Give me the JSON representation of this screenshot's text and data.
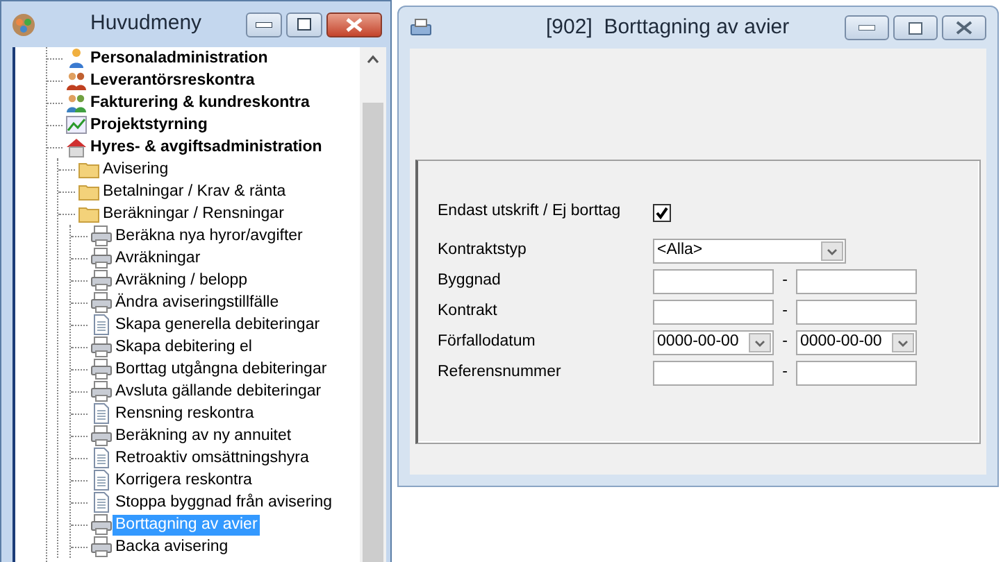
{
  "main_menu": {
    "title": "Huvudmeny",
    "tree": [
      {
        "label": "Personaladministration",
        "kind": "person",
        "selected": false
      },
      {
        "label": "Leverantörsreskontra",
        "kind": "people",
        "selected": false
      },
      {
        "label": "Fakturering & kundreskontra",
        "kind": "group",
        "selected": false
      },
      {
        "label": "Projektstyrning",
        "kind": "chart",
        "selected": false
      },
      {
        "label": "Hyres- & avgiftsadministration",
        "kind": "house",
        "selected": false,
        "children": [
          {
            "label": "Avisering",
            "kind": "folder",
            "selected": false
          },
          {
            "label": "Betalningar / Krav & ränta",
            "kind": "folder",
            "selected": false
          },
          {
            "label": "Beräkningar / Rensningar",
            "kind": "folder",
            "selected": false,
            "children": [
              {
                "label": "Beräkna nya hyror/avgifter",
                "kind": "printer",
                "selected": false
              },
              {
                "label": "Avräkningar",
                "kind": "printer",
                "selected": false
              },
              {
                "label": "Avräkning / belopp",
                "kind": "printer",
                "selected": false
              },
              {
                "label": "Ändra aviseringstillfälle",
                "kind": "printer",
                "selected": false
              },
              {
                "label": "Skapa generella debiteringar",
                "kind": "document",
                "selected": false
              },
              {
                "label": "Skapa debitering el",
                "kind": "printer",
                "selected": false
              },
              {
                "label": "Borttag utgångna debiteringar",
                "kind": "printer",
                "selected": false
              },
              {
                "label": "Avsluta gällande debiteringar",
                "kind": "printer",
                "selected": false
              },
              {
                "label": "Rensning reskontra",
                "kind": "document",
                "selected": false
              },
              {
                "label": "Beräkning av ny annuitet",
                "kind": "printer",
                "selected": false
              },
              {
                "label": "Retroaktiv omsättningshyra",
                "kind": "document",
                "selected": false
              },
              {
                "label": "Korrigera reskontra",
                "kind": "document",
                "selected": false
              },
              {
                "label": "Stoppa byggnad från avisering",
                "kind": "document",
                "selected": false
              },
              {
                "label": "Borttagning av avier",
                "kind": "printer",
                "selected": true
              },
              {
                "label": "Backa avisering",
                "kind": "printer",
                "selected": false
              }
            ]
          }
        ]
      }
    ]
  },
  "dialog": {
    "title": "[902]  Borttagning av avier",
    "checkbox": {
      "label": "Endast utskrift / Ej borttag",
      "checked": true
    },
    "fields": [
      {
        "label": "Kontraktstyp",
        "kind": "combo",
        "value": "<Alla>"
      },
      {
        "label": "Byggnad",
        "kind": "range",
        "separator": "-"
      },
      {
        "label": "Kontrakt",
        "kind": "range",
        "separator": "-"
      },
      {
        "label": "Förfallodatum",
        "kind": "date_range",
        "from": "0000-00-00",
        "to": "0000-00-00",
        "separator": "-"
      },
      {
        "label": "Referensnummer",
        "kind": "range",
        "separator": "-"
      }
    ]
  }
}
